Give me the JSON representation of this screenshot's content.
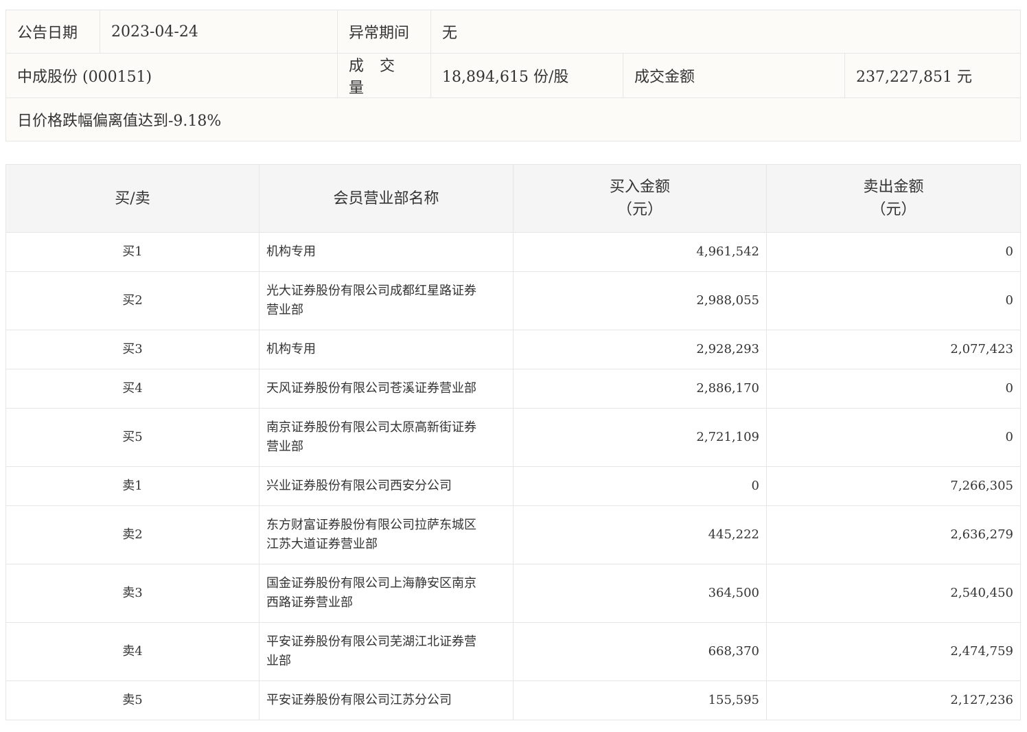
{
  "info": {
    "announce_date_label": "公告日期",
    "announce_date_value": "2023-04-24",
    "abnormal_period_label": "异常期间",
    "abnormal_period_value": "无",
    "stock_name": "中成股份 (000151)",
    "volume_label": "成 交 量",
    "volume_value": "18,894,615 份/股",
    "amount_label": "成交金额",
    "amount_value": "237,227,851 元",
    "reason": "日价格跌幅偏离值达到-9.18%"
  },
  "table": {
    "headers": {
      "side": "买/卖",
      "member": "会员营业部名称",
      "buy_line1": "买入金额",
      "buy_line2": "（元）",
      "sell_line1": "卖出金额",
      "sell_line2": "（元）"
    },
    "rows": [
      {
        "side": "买1",
        "member_line1": "机构专用",
        "member_line2": "",
        "buy": "4,961,542",
        "sell": "0"
      },
      {
        "side": "买2",
        "member_line1": "光大证券股份有限公司成都红星路证券",
        "member_line2": "营业部",
        "buy": "2,988,055",
        "sell": "0"
      },
      {
        "side": "买3",
        "member_line1": "机构专用",
        "member_line2": "",
        "buy": "2,928,293",
        "sell": "2,077,423"
      },
      {
        "side": "买4",
        "member_line1": "天风证券股份有限公司苍溪证券营业部",
        "member_line2": "",
        "buy": "2,886,170",
        "sell": "0"
      },
      {
        "side": "买5",
        "member_line1": "南京证券股份有限公司太原高新街证券",
        "member_line2": "营业部",
        "buy": "2,721,109",
        "sell": "0"
      },
      {
        "side": "卖1",
        "member_line1": "兴业证券股份有限公司西安分公司",
        "member_line2": "",
        "buy": "0",
        "sell": "7,266,305"
      },
      {
        "side": "卖2",
        "member_line1": "东方财富证券股份有限公司拉萨东城区",
        "member_line2": "江苏大道证券营业部",
        "buy": "445,222",
        "sell": "2,636,279"
      },
      {
        "side": "卖3",
        "member_line1": "国金证券股份有限公司上海静安区南京",
        "member_line2": "西路证券营业部",
        "buy": "364,500",
        "sell": "2,540,450"
      },
      {
        "side": "卖4",
        "member_line1": "平安证券股份有限公司芜湖江北证券营",
        "member_line2": "业部",
        "buy": "668,370",
        "sell": "2,474,759"
      },
      {
        "side": "卖5",
        "member_line1": "平安证券股份有限公司江苏分公司",
        "member_line2": "",
        "buy": "155,595",
        "sell": "2,127,236"
      }
    ]
  }
}
